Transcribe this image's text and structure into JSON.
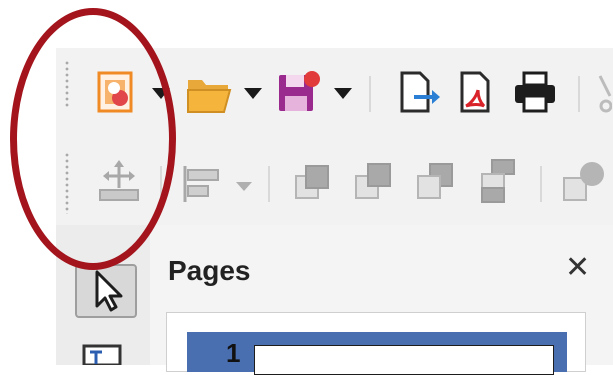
{
  "toolbar_row1": {
    "items": [
      {
        "name": "new-document-icon",
        "dropdown": true
      },
      {
        "name": "open-folder-icon",
        "dropdown": true
      },
      {
        "name": "save-icon",
        "dropdown": true
      },
      {
        "name": "export-icon",
        "dropdown": false
      },
      {
        "name": "export-pdf-icon",
        "dropdown": false
      },
      {
        "name": "print-icon",
        "dropdown": false
      }
    ]
  },
  "toolbar_row2": {
    "items": [
      {
        "name": "transformations-icon",
        "disabled": true
      },
      {
        "name": "align-objects-icon",
        "disabled": true,
        "dropdown": true
      },
      {
        "name": "bring-to-front-icon",
        "disabled": true
      },
      {
        "name": "bring-forward-icon",
        "disabled": true
      },
      {
        "name": "send-backward-icon",
        "disabled": true
      },
      {
        "name": "send-to-back-icon",
        "disabled": true
      },
      {
        "name": "shadow-icon",
        "disabled": true
      }
    ]
  },
  "sidebar": {
    "tools": [
      {
        "name": "select-arrow-icon",
        "selected": true
      },
      {
        "name": "text-box-icon",
        "selected": false
      }
    ]
  },
  "pages_panel": {
    "title": "Pages",
    "close_symbol": "✕",
    "thumbnails": [
      {
        "number": "1",
        "selected": true
      }
    ]
  },
  "colors": {
    "annotation": "#a3141c",
    "accent_orange": "#f08a24",
    "save_purple": "#9b2a8f",
    "selection_blue": "#4a6fb0"
  }
}
